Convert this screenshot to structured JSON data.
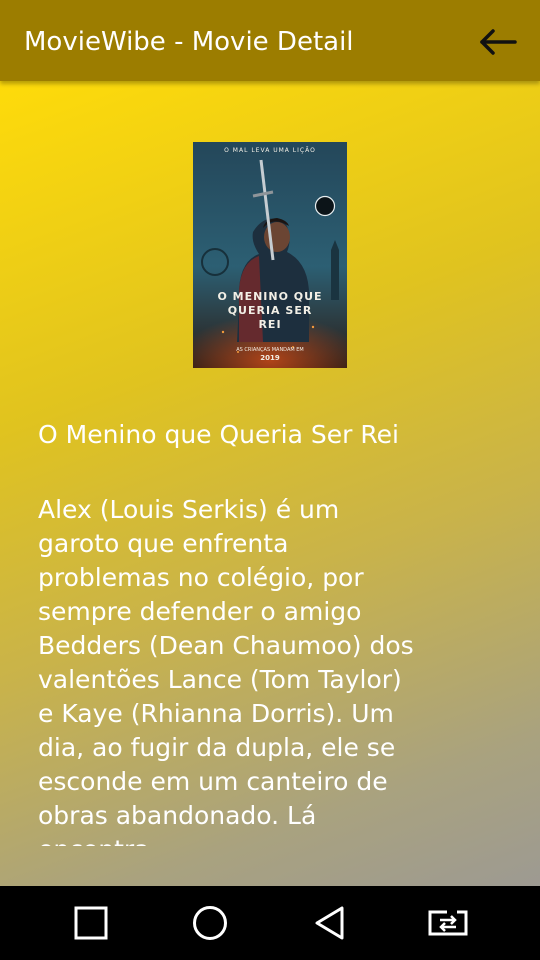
{
  "appbar": {
    "title": "MovieWibe - Movie Detail",
    "back_icon": "arrow-left-icon"
  },
  "movie": {
    "poster": {
      "tagline": "O MAL LEVA UMA LIÇÃO",
      "title_art": "O MENINO QUE QUERIA SER REI",
      "release_text": "AS CRIANÇAS MANDAM EM",
      "release_year": "2019"
    },
    "title": "O Menino que Queria Ser Rei",
    "description": "Alex (Louis Serkis) é um garoto que enfrenta problemas no colégio, por sempre defender o amigo Bedders (Dean Chaumoo) dos valentões Lance (Tom Taylor) e Kaye (Rhianna Dorris). Um dia, ao fugir da dupla, ele se esconde em um canteiro de obras abandonado. Lá encontra"
  },
  "colors": {
    "appbar": "#9c7d00",
    "gradient_start": "#fedb0a",
    "gradient_end": "#9d9a92",
    "text": "#ffffff",
    "navbar": "#000000"
  },
  "system_nav": {
    "buttons": [
      "square-recents-icon",
      "circle-home-icon",
      "triangle-back-icon",
      "screen-cast-icon"
    ]
  }
}
